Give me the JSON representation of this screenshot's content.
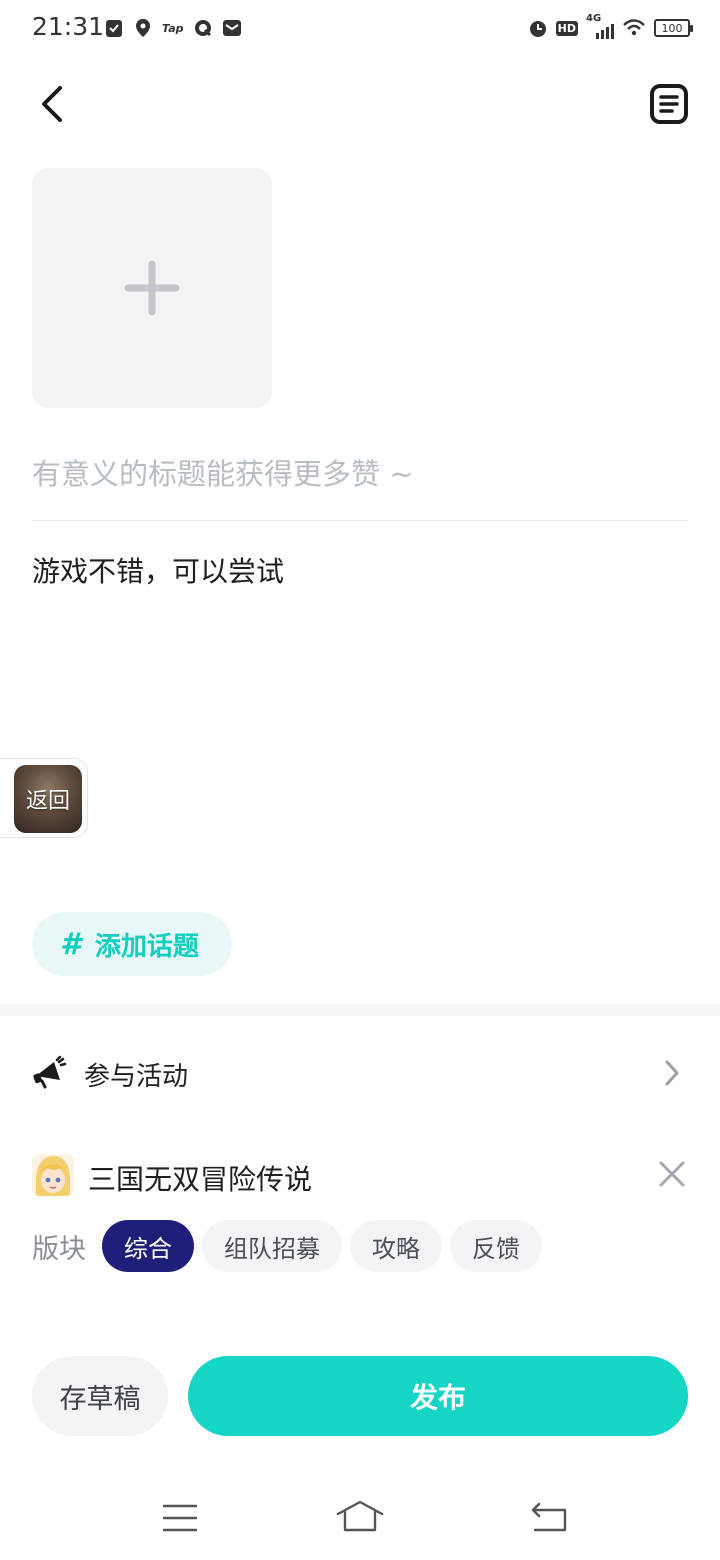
{
  "status_bar": {
    "time": "21:31",
    "left_icons": [
      "check-notification-icon",
      "location-pin-icon",
      "tap-app-icon",
      "q-app-icon",
      "mail-icon"
    ],
    "tap_text": "Tap",
    "hd_text": "HD",
    "network_text": "4G",
    "battery": "100",
    "right_icons": [
      "alarm-icon",
      "hd-icon",
      "signal-icon",
      "wifi-icon",
      "battery-icon"
    ]
  },
  "nav": {
    "back_icon": "back-arrow-icon",
    "drafts_icon": "document-icon"
  },
  "editor": {
    "add_image_icon": "plus-icon",
    "title_placeholder": "有意义的标题能获得更多赞 ~",
    "title_value": "",
    "body_text": "游戏不错，可以尝试"
  },
  "float_back": {
    "label": "返回"
  },
  "topic": {
    "hash": "#",
    "label": "添加话题"
  },
  "activity": {
    "label": "参与活动",
    "icon": "megaphone-icon"
  },
  "game": {
    "name": "三国无双冒险传说"
  },
  "board": {
    "label": "版块",
    "options": [
      {
        "label": "综合",
        "active": true
      },
      {
        "label": "组队招募",
        "active": false
      },
      {
        "label": "攻略",
        "active": false
      },
      {
        "label": "反馈",
        "active": false
      }
    ]
  },
  "actions": {
    "draft_label": "存草稿",
    "publish_label": "发布"
  },
  "colors": {
    "accent": "#15d6c5",
    "active_chip": "#1f1f7a",
    "placeholder": "#b8bdc4"
  }
}
